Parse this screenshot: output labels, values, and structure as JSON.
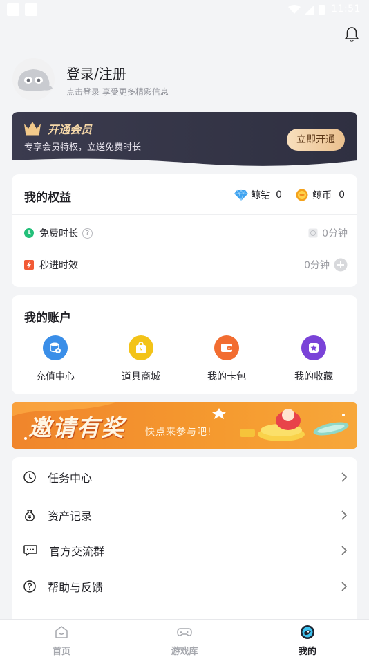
{
  "status_bar": {
    "time": "11:51"
  },
  "profile": {
    "title": "登录/注册",
    "subtitle": "点击登录 享受更多精彩信息"
  },
  "vip": {
    "title": "开通会员",
    "subtitle": "专享会员特权，立送免费时长",
    "button": "立即开通"
  },
  "rights": {
    "title": "我的权益",
    "diamond_label": "鲸钻",
    "diamond_value": "0",
    "coin_label": "鲸币",
    "coin_value": "0",
    "rows": [
      {
        "label": "免费时长",
        "help": "?",
        "value": "0分钟"
      },
      {
        "label": "秒进时效",
        "value": "0分钟"
      }
    ]
  },
  "account": {
    "title": "我的账户",
    "items": [
      {
        "label": "充值中心",
        "icon": "recharge-icon",
        "color": "#3a8ee8"
      },
      {
        "label": "道具商城",
        "icon": "shop-bag-icon",
        "color": "#f3c318"
      },
      {
        "label": "我的卡包",
        "icon": "wallet-icon",
        "color": "#f26d31"
      },
      {
        "label": "我的收藏",
        "icon": "star-collection-icon",
        "color": "#7a43d8"
      }
    ]
  },
  "invite_banner": {
    "title": "邀请有奖",
    "subtitle": "快点来参与吧!"
  },
  "menu": {
    "items": [
      {
        "label": "任务中心",
        "icon": "clock-icon"
      },
      {
        "label": "资产记录",
        "icon": "money-bag-icon"
      },
      {
        "label": "官方交流群",
        "icon": "chat-icon"
      },
      {
        "label": "帮助与反馈",
        "icon": "help-circle-icon"
      }
    ]
  },
  "bottom_nav": {
    "items": [
      {
        "label": "首页",
        "icon": "home-icon"
      },
      {
        "label": "游戏库",
        "icon": "gamepad-icon"
      },
      {
        "label": "我的",
        "icon": "profile-icon",
        "active": true
      }
    ]
  },
  "colors": {
    "accent_dark": "#3a3a4c",
    "vip_gold": "#f6d8a8",
    "invite_orange": "#f28a2d"
  }
}
